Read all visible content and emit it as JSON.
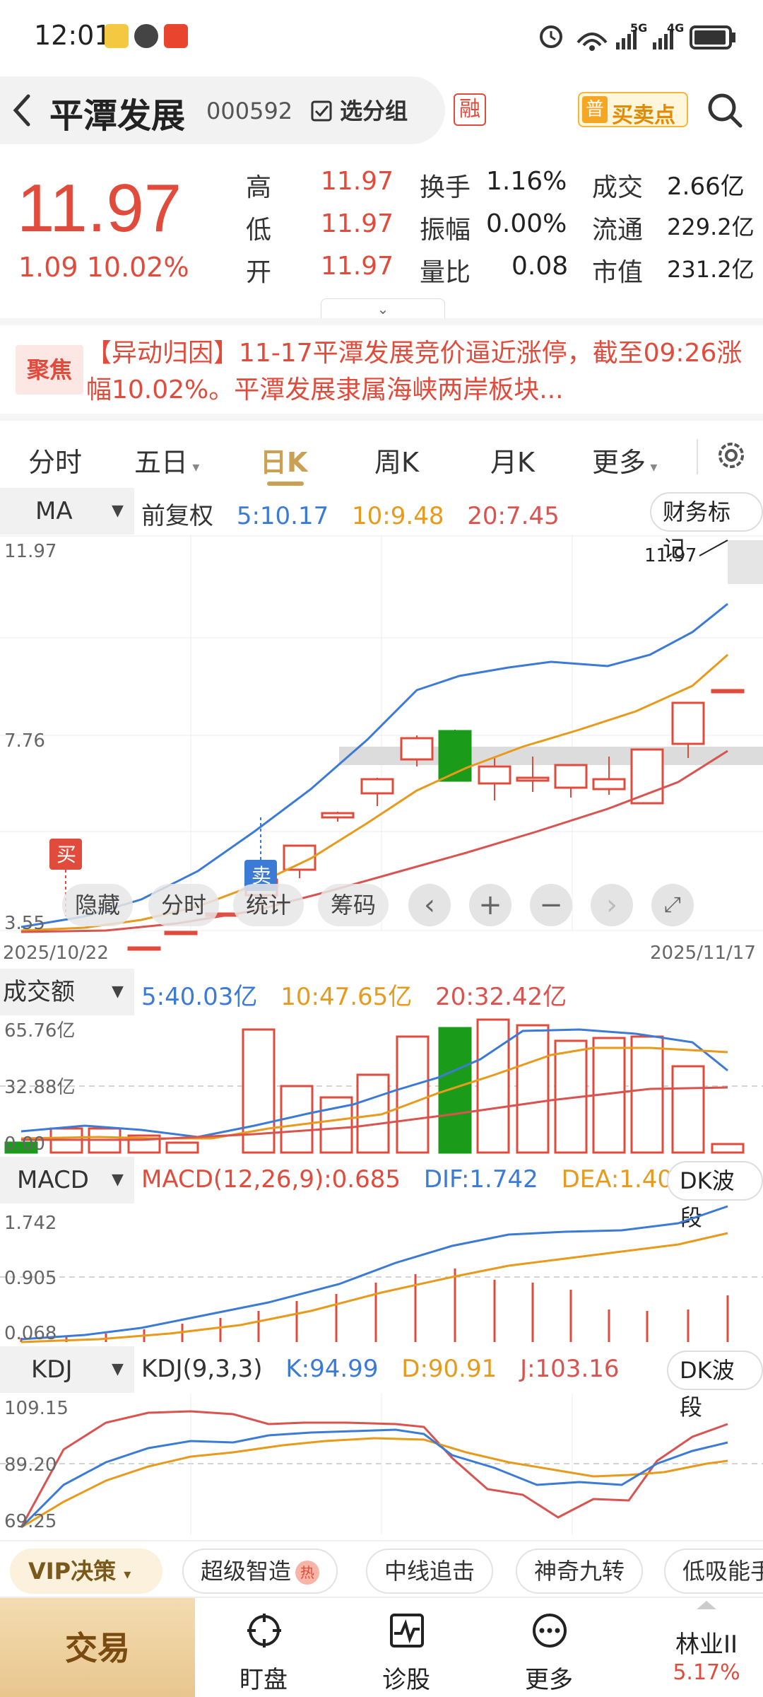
{
  "status_bar": {
    "time": "12:01",
    "network1": "5G",
    "network2": "4G"
  },
  "header": {
    "stock_name": "平潭发展",
    "stock_code": "000592",
    "group_button": "选分组",
    "margin_badge": "融",
    "buysell_tag": "普",
    "buysell_label": "买卖点"
  },
  "quote": {
    "last_price": "11.97",
    "change": "1.09 10.02%",
    "high_label": "高",
    "high": "11.97",
    "low_label": "低",
    "low": "11.97",
    "open_label": "开",
    "open": "11.97",
    "turnover_label": "换手",
    "turnover": "1.16%",
    "amplitude_label": "振幅",
    "amplitude": "0.00%",
    "volume_ratio_label": "量比",
    "volume_ratio": "0.08",
    "amount_label": "成交",
    "amount": "2.66亿",
    "float_cap_label": "流通",
    "float_cap": "229.2亿",
    "market_cap_label": "市值",
    "market_cap": "231.2亿"
  },
  "news": {
    "badge": "聚焦",
    "text": "【异动归因】11-17平潭发展竞价逼近涨停，截至09:26涨幅10.02%。平潭发展隶属海峡两岸板块..."
  },
  "tabs": [
    "分时",
    "五日",
    "日K",
    "周K",
    "月K",
    "更多"
  ],
  "active_tab": "日K",
  "main_chart": {
    "indicator": "MA",
    "adjust": "前复权",
    "ma5": "5:10.17",
    "ma10": "10:9.48",
    "ma20": "20:7.45",
    "finance_button": "财务标记",
    "y_top": "11.97",
    "y_mid": "7.76",
    "y_bottom": "3.55",
    "high_marker": "11.97",
    "buy_marker": "买",
    "sell_marker": "卖",
    "date_start": "2025/10/22",
    "date_end": "2025/11/17",
    "overlay": {
      "hide": "隐藏",
      "intraday": "分时",
      "stats": "统计",
      "chips": "筹码"
    }
  },
  "volume_chart": {
    "indicator": "成交额",
    "ma5": "5:40.03亿",
    "ma10": "10:47.65亿",
    "ma20": "20:32.42亿",
    "y_top": "65.76亿",
    "y_mid": "32.88亿",
    "y_bottom": "0.00"
  },
  "macd_chart": {
    "indicator": "MACD",
    "params": "MACD(12,26,9):0.685",
    "dif": "DIF:1.742",
    "dea": "DEA:1.400",
    "button": "DK波段",
    "y_top": "1.742",
    "y_mid": "0.905",
    "y_bottom": "0.068"
  },
  "kdj_chart": {
    "indicator": "KDJ",
    "params": "KDJ(9,3,3)",
    "k": "K:94.99",
    "d": "D:90.91",
    "j": "J:103.16",
    "button": "DK波段",
    "y_top": "109.15",
    "y_mid": "89.20",
    "y_bottom": "69.25"
  },
  "chips": {
    "vip": "VIP决策",
    "items": [
      "超级智造",
      "中线追击",
      "神奇九转",
      "低吸能手"
    ],
    "hot_tag": "热"
  },
  "bottom_nav": {
    "trade": "交易",
    "items": [
      "盯盘",
      "诊股",
      "更多"
    ],
    "sector_name": "林业II",
    "sector_change": "5.17%"
  },
  "colors": {
    "up": "#e14b3b",
    "down": "#1a9c1a",
    "ma5": "#3b7bd6",
    "ma10": "#e79a1b",
    "ma20": "#d9534f",
    "accent": "#caa055"
  }
}
